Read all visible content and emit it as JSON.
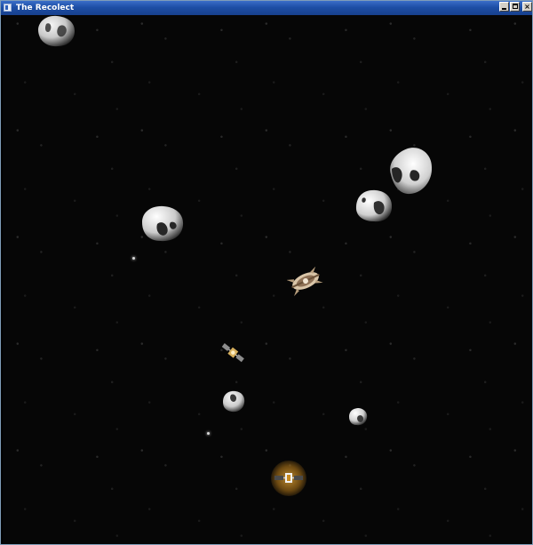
{
  "window": {
    "title": "The Recolect",
    "controls": {
      "minimize": "_",
      "maximize": "□",
      "close": "×"
    }
  },
  "game": {
    "background_color": "#060606",
    "scene": [
      {
        "type": "asteroid",
        "icon": "asteroid-icon",
        "size": "large"
      },
      {
        "type": "asteroid",
        "icon": "asteroid-icon",
        "size": "large"
      },
      {
        "type": "asteroid",
        "icon": "asteroid-icon",
        "size": "large"
      },
      {
        "type": "asteroid",
        "icon": "asteroid-icon",
        "size": "medium"
      },
      {
        "type": "asteroid",
        "icon": "asteroid-icon",
        "size": "small"
      },
      {
        "type": "asteroid",
        "icon": "asteroid-icon",
        "size": "small"
      },
      {
        "type": "asteroid",
        "icon": "asteroid-icon",
        "size": "large"
      },
      {
        "type": "spaceship",
        "icon": "spaceship-icon"
      },
      {
        "type": "satellite",
        "icon": "satellite-icon"
      },
      {
        "type": "player-satellite",
        "icon": "satellite-icon",
        "highlight_color": "#c88a1f"
      }
    ]
  }
}
